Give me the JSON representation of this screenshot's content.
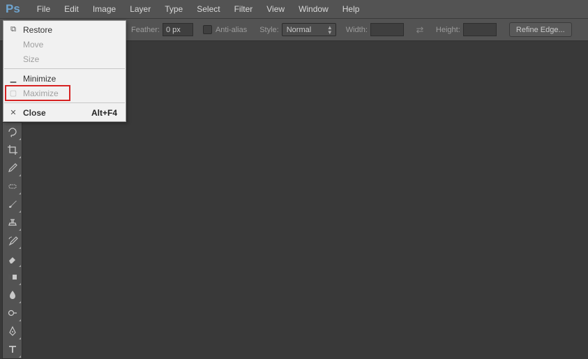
{
  "app": {
    "logo": "Ps"
  },
  "menu": {
    "file": "File",
    "edit": "Edit",
    "image": "Image",
    "layer": "Layer",
    "type": "Type",
    "select": "Select",
    "filter": "Filter",
    "view": "View",
    "window": "Window",
    "help": "Help"
  },
  "options": {
    "feather_label": "Feather:",
    "feather_value": "0 px",
    "antialias_label": "Anti-alias",
    "style_label": "Style:",
    "style_value": "Normal",
    "width_label": "Width:",
    "width_value": "",
    "height_label": "Height:",
    "height_value": "",
    "refine_label": "Refine Edge..."
  },
  "context_menu": {
    "restore": "Restore",
    "move": "Move",
    "size": "Size",
    "minimize": "Minimize",
    "maximize": "Maximize",
    "close": "Close",
    "close_shortcut": "Alt+F4"
  }
}
